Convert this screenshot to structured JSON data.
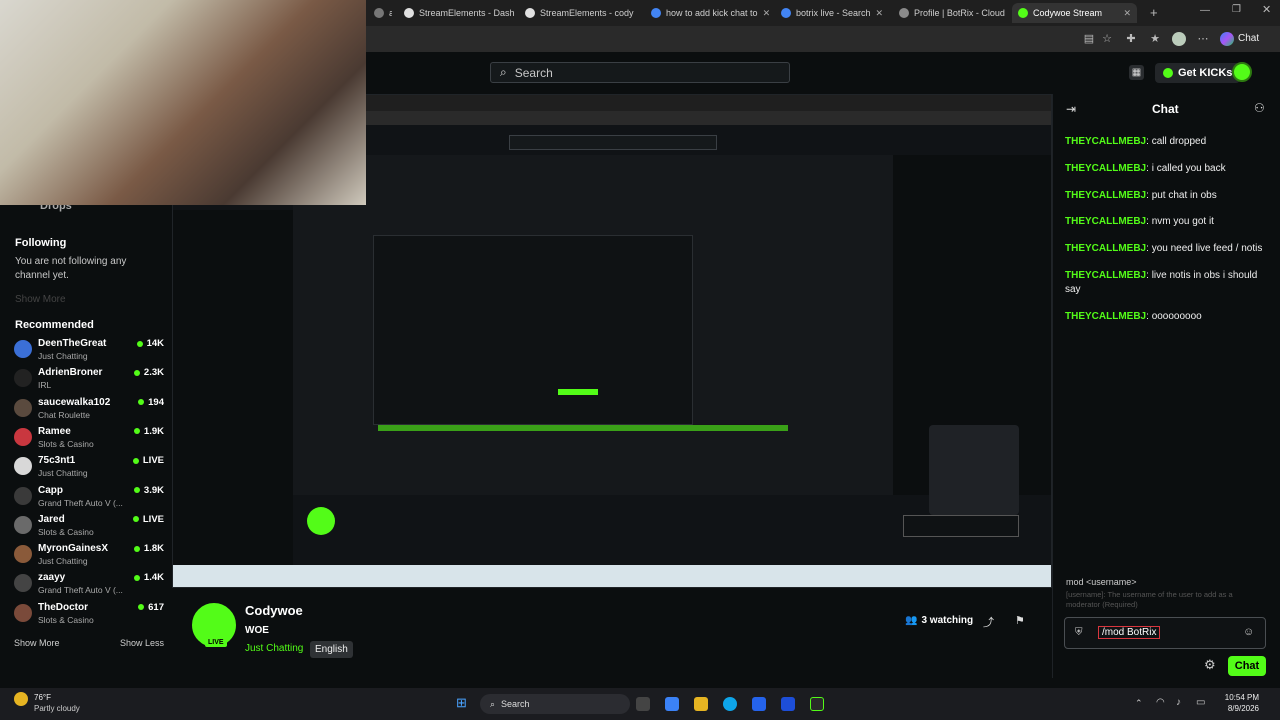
{
  "browser": {
    "tabs": [
      {
        "label": "ar",
        "color": "#777"
      },
      {
        "label": "StreamElements - Dashb",
        "color": "#e0e0e0"
      },
      {
        "label": "StreamElements - cody",
        "color": "#e0e0e0"
      },
      {
        "label": "how to add kick chat to",
        "color": "#4285f4"
      },
      {
        "label": "botrix live - Search",
        "color": "#4285f4"
      },
      {
        "label": "Profile | BotRix - Cloud",
        "color": "#8a8a8a"
      },
      {
        "label": "Codywoe Stream",
        "color": "#53fc18"
      }
    ],
    "chat_label": "Chat"
  },
  "topnav": {
    "search_placeholder": "Search",
    "get_kicks": "Get KICKs"
  },
  "sidebar": {
    "drops": "Drops",
    "following_title": "Following",
    "following_empty": "You are not following any channel yet.",
    "show_more_faint": "Show More",
    "recommended_title": "Recommended",
    "channels": [
      {
        "name": "DeenTheGreat",
        "category": "Just Chatting",
        "viewers": "14K",
        "avatar_color": "#3b6fd6"
      },
      {
        "name": "AdrienBroner",
        "category": "IRL",
        "viewers": "2.3K",
        "avatar_color": "#222"
      },
      {
        "name": "saucewalka102",
        "category": "Chat Roulette",
        "viewers": "194",
        "avatar_color": "#5a4a3e"
      },
      {
        "name": "Ramee",
        "category": "Slots & Casino",
        "viewers": "1.9K",
        "avatar_color": "#c9373f"
      },
      {
        "name": "75c3nt1",
        "category": "Just Chatting",
        "viewers": "LIVE",
        "avatar_color": "#d8d8d8"
      },
      {
        "name": "Capp",
        "category": "Grand Theft Auto V (...",
        "viewers": "3.9K",
        "avatar_color": "#3a3a3a"
      },
      {
        "name": "Jared",
        "category": "Slots & Casino",
        "viewers": "LIVE",
        "avatar_color": "#6a6a6a"
      },
      {
        "name": "MyronGainesX",
        "category": "Just Chatting",
        "viewers": "1.8K",
        "avatar_color": "#8a5a3a"
      },
      {
        "name": "zaayy",
        "category": "Grand Theft Auto V (...",
        "viewers": "1.4K",
        "avatar_color": "#444"
      },
      {
        "name": "TheDoctor",
        "category": "Slots & Casino",
        "viewers": "617",
        "avatar_color": "#7a4a3a"
      }
    ],
    "show_more": "Show More",
    "show_less": "Show Less"
  },
  "stream": {
    "channel": "Codywoe",
    "title": "WOE",
    "category": "Just Chatting",
    "language": "English",
    "watching": "3 watching",
    "live_badge": "LIVE"
  },
  "chat": {
    "title": "Chat",
    "messages": [
      {
        "user": "THEYCALLMEBJ",
        "text": "call dropped"
      },
      {
        "user": "THEYCALLMEBJ",
        "text": "i called you back"
      },
      {
        "user": "THEYCALLMEBJ",
        "text": "put chat in obs"
      },
      {
        "user": "THEYCALLMEBJ",
        "text": "nvm you got it"
      },
      {
        "user": "THEYCALLMEBJ",
        "text": "you need live feed / notis"
      },
      {
        "user": "THEYCALLMEBJ",
        "text": "live notis in obs i should say"
      },
      {
        "user": "THEYCALLMEBJ",
        "text": "ooooooooo"
      }
    ],
    "command_hint": "mod <username>",
    "command_desc": "[username]: The username of the user to add as a moderator (Required)",
    "input_value": "/mod BotRix",
    "send_label": "Chat"
  },
  "taskbar": {
    "temperature": "76°F",
    "weather": "Partly cloudy",
    "search": "Search",
    "time": "10:54 PM",
    "date": "8/9/2026"
  },
  "colors": {
    "accent": "#53fc18",
    "background": "#0b0e0f"
  }
}
